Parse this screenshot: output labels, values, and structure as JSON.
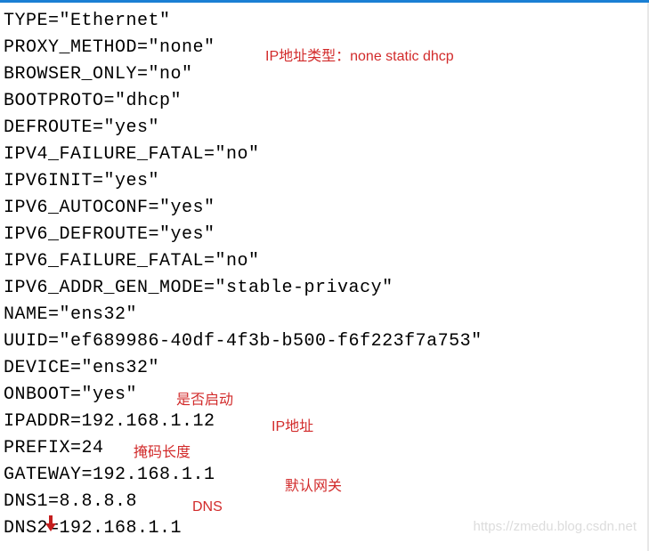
{
  "config": {
    "lines": [
      "TYPE=\"Ethernet\"",
      "PROXY_METHOD=\"none\"",
      "BROWSER_ONLY=\"no\"",
      "BOOTPROTO=\"dhcp\"",
      "DEFROUTE=\"yes\"",
      "IPV4_FAILURE_FATAL=\"no\"",
      "IPV6INIT=\"yes\"",
      "IPV6_AUTOCONF=\"yes\"",
      "IPV6_DEFROUTE=\"yes\"",
      "IPV6_FAILURE_FATAL=\"no\"",
      "IPV6_ADDR_GEN_MODE=\"stable-privacy\"",
      "NAME=\"ens32\"",
      "UUID=\"ef689986-40df-4f3b-b500-f6f223f7a753\"",
      "DEVICE=\"ens32\"",
      "ONBOOT=\"yes\"",
      "IPADDR=192.168.1.12",
      "PREFIX=24",
      "GATEWAY=192.168.1.1",
      "DNS1=8.8.8.8",
      "DNS2=192.168.1.1"
    ]
  },
  "annotations": {
    "ip_type": "IP地址类型：none static dhcp",
    "onboot": "是否启动",
    "ipaddr": "IP地址",
    "prefix": "掩码长度",
    "gateway": "默认网关",
    "dns": "DNS"
  },
  "watermark": "https://zmedu.blog.csdn.net"
}
